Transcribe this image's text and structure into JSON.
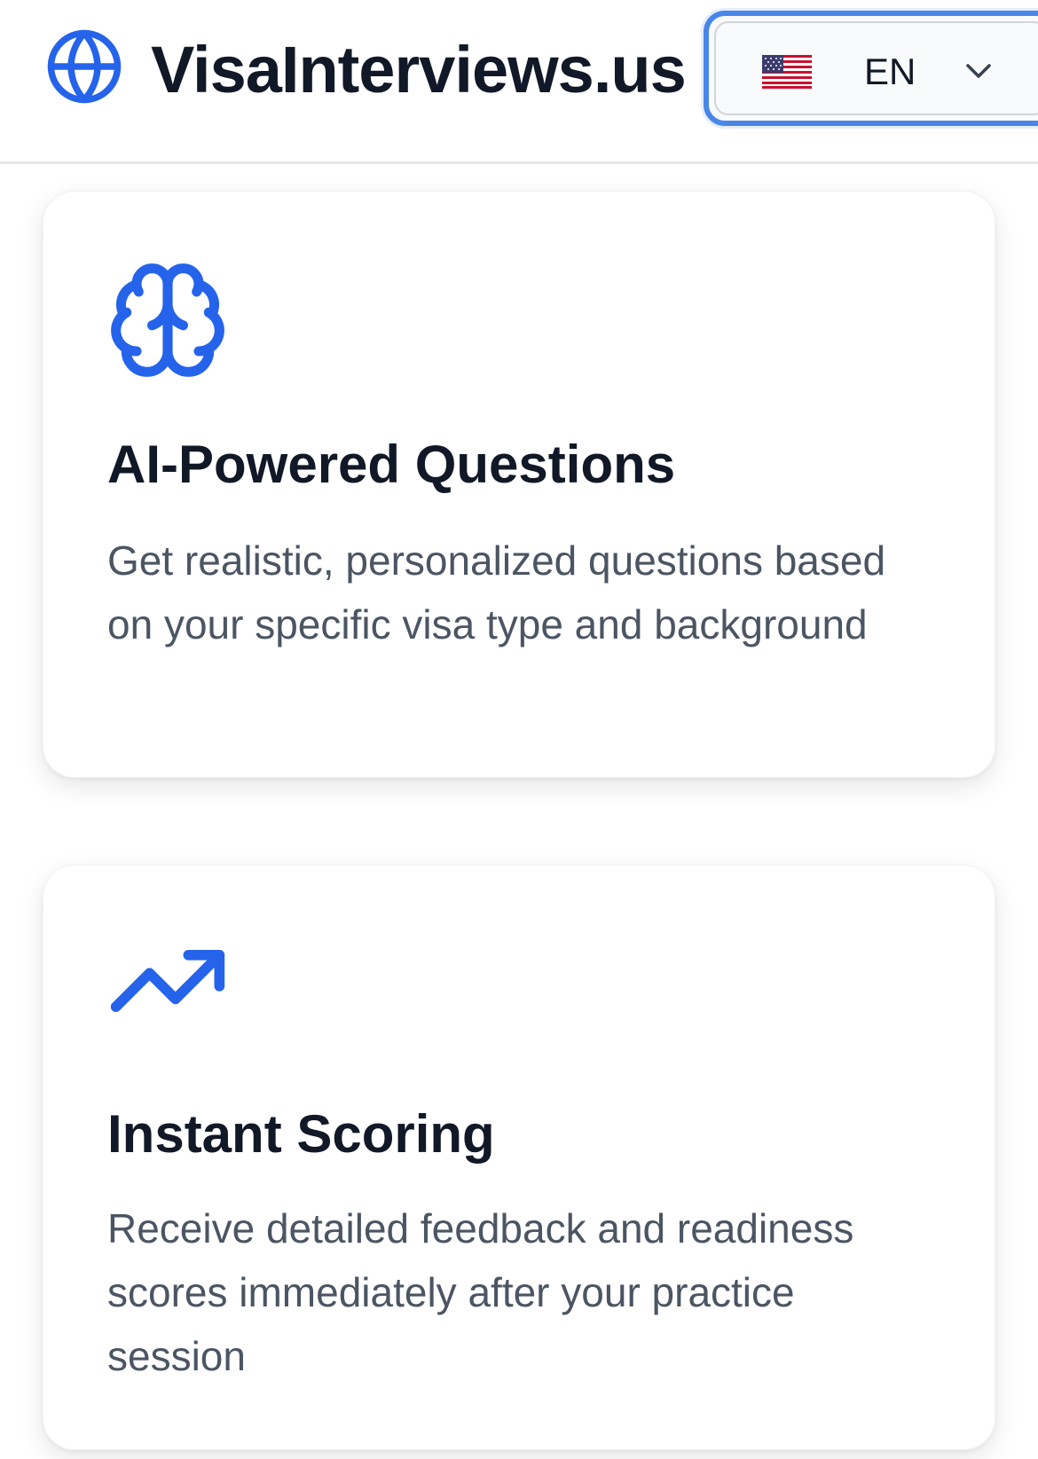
{
  "header": {
    "brand_icon": "globe-icon",
    "brand_name": "VisaInterviews.us",
    "language": {
      "flag_icon": "us-flag-icon",
      "code": "EN",
      "dropdown_icon": "chevron-down-icon"
    }
  },
  "features": [
    {
      "icon": "brain-icon",
      "title": "AI-Powered Questions",
      "description": "Get realistic, personalized questions based on your specific visa type and background"
    },
    {
      "icon": "trending-up-icon",
      "title": "Instant Scoring",
      "description": "Receive detailed feedback and readiness scores immediately after your practice session"
    }
  ],
  "colors": {
    "accent": "#2563eb",
    "text_primary": "#111827",
    "text_secondary": "#4b5563",
    "focus_ring": "#4a86e8"
  }
}
